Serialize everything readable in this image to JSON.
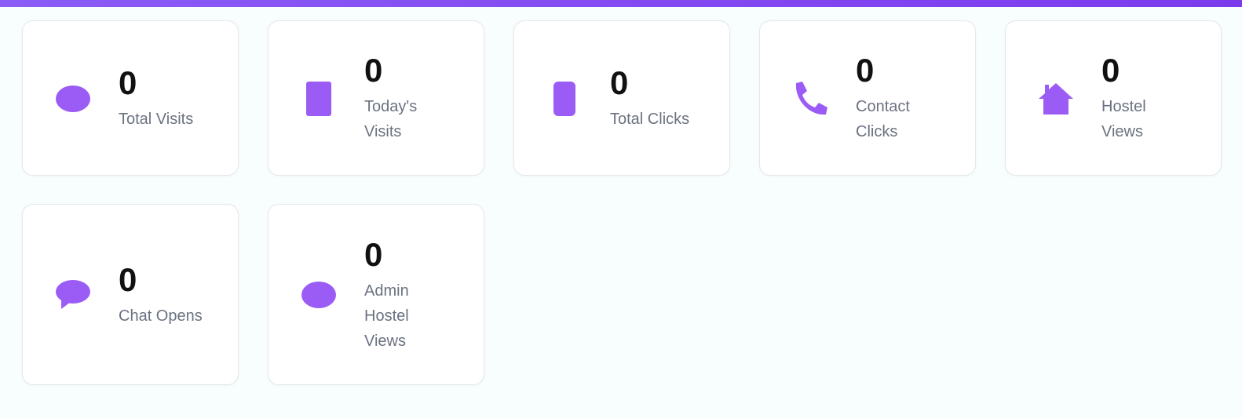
{
  "colors": {
    "accent": "#8b5cf6",
    "icon": "#9b5cf6",
    "label": "#6b7280",
    "value": "#111111"
  },
  "stats": [
    {
      "value": "0",
      "label": "Total Visits",
      "icon": "eye-icon"
    },
    {
      "value": "0",
      "label": "Today's\nVisits",
      "icon": "calendar-icon"
    },
    {
      "value": "0",
      "label": "Total Clicks",
      "icon": "mouse-icon"
    },
    {
      "value": "0",
      "label": "Contact\nClicks",
      "icon": "phone-icon"
    },
    {
      "value": "0",
      "label": "Hostel\nViews",
      "icon": "home-icon"
    },
    {
      "value": "0",
      "label": "Chat Opens",
      "icon": "chat-icon"
    },
    {
      "value": "0",
      "label": "Admin\nHostel\nViews",
      "icon": "eye-icon"
    }
  ]
}
